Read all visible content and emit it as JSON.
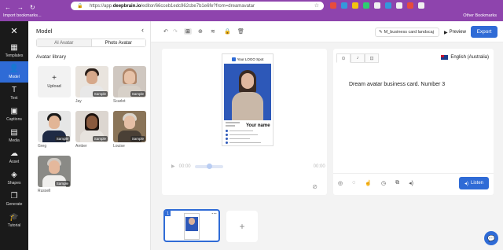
{
  "browser": {
    "url_prefix": "https://app.",
    "url_domain": "deepbrain.io",
    "url_rest": "/editor/66cceb1edc962cbe7b1e6fe?from=dreamavatar",
    "bookmarks": "Import bookmarks...",
    "other_bookmarks": "Other Bookmarks"
  },
  "sidebar": {
    "items": [
      {
        "label": "Templates",
        "icon": "layout-icon"
      },
      {
        "label": "Model",
        "icon": "person-icon"
      },
      {
        "label": "Text",
        "icon": "text-icon"
      },
      {
        "label": "Captions",
        "icon": "cc-icon"
      },
      {
        "label": "Media",
        "icon": "media-icon"
      },
      {
        "label": "Asset",
        "icon": "asset-icon"
      },
      {
        "label": "Shapes",
        "icon": "shapes-icon"
      },
      {
        "label": "Generate",
        "icon": "generate-icon"
      },
      {
        "label": "Tutorial",
        "icon": "tutorial-icon"
      }
    ]
  },
  "panel": {
    "title": "Model",
    "tabs": [
      "AI Avatar",
      "Photo Avatar"
    ],
    "library_label": "Avatar library",
    "upload_label": "Upload",
    "avatars": [
      {
        "name": "Jay",
        "badge": "Sample"
      },
      {
        "name": "Scarlet",
        "badge": "Sample"
      },
      {
        "name": "Greg",
        "badge": "Sample"
      },
      {
        "name": "Amber",
        "badge": "Sample"
      },
      {
        "name": "Louise",
        "badge": "Sample"
      },
      {
        "name": "Russell",
        "badge": "Sample"
      }
    ]
  },
  "toolbar": {
    "file_name": "M_business card landscaj",
    "preview_label": "Preview",
    "export_label": "Export"
  },
  "card": {
    "logo_text": "Your LOGO Spot",
    "name_text": "Your name"
  },
  "player": {
    "current_time": "00:00",
    "end_time": "00:00"
  },
  "script": {
    "language": "English (Australia)",
    "text": "Dream avatar business card. Number 3",
    "listen_label": "Listen"
  },
  "scenes": {
    "items": [
      {
        "number": "1"
      }
    ]
  }
}
